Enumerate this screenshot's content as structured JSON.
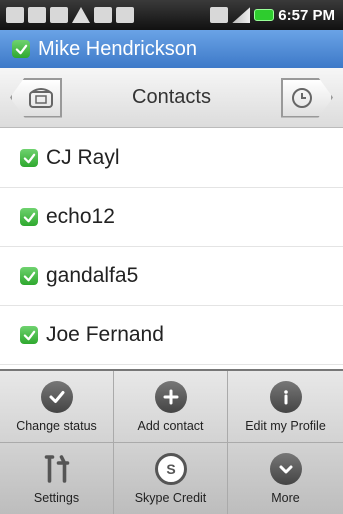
{
  "status_bar": {
    "time": "6:57 PM",
    "icons": [
      "phone-icon",
      "keyboard-icon",
      "usb-icon",
      "warning-icon",
      "sim-icon",
      "debug-icon"
    ],
    "right_icons": [
      "network-icon",
      "signal-icon",
      "battery-icon"
    ]
  },
  "title_bar": {
    "user_name": "Mike Hendrickson",
    "presence_icon": "online-check-icon"
  },
  "tab_header": {
    "title": "Contacts",
    "left_icon": "phone-icon",
    "right_icon": "clock-icon"
  },
  "contacts": [
    {
      "name": "CJ Rayl"
    },
    {
      "name": "echo12"
    },
    {
      "name": "gandalfa5"
    },
    {
      "name": "Joe Fernand"
    }
  ],
  "menu": {
    "items": [
      {
        "label": "Change status",
        "icon": "check-icon"
      },
      {
        "label": "Add contact",
        "icon": "plus-icon"
      },
      {
        "label": "Edit my Profile",
        "icon": "info-icon"
      },
      {
        "label": "Settings",
        "icon": "tools-icon"
      },
      {
        "label": "Skype Credit",
        "icon": "skype-icon"
      },
      {
        "label": "More",
        "icon": "chevron-down-icon"
      }
    ]
  },
  "colors": {
    "title_bar": "#4a86d4",
    "presence_green": "#3bb83b",
    "status_bar": "#222222"
  }
}
